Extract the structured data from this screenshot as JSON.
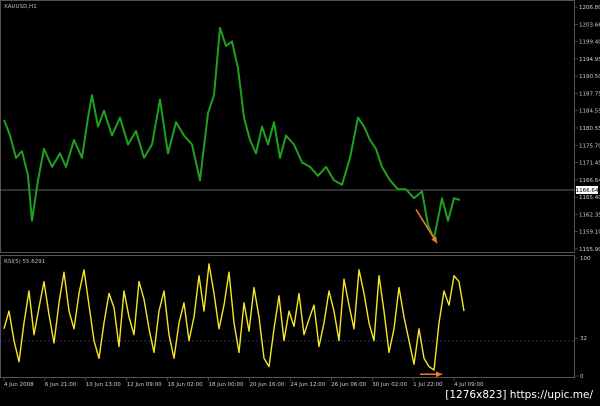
{
  "watermark": "[1276x823] https://upic.me/",
  "colors": {
    "background": "#000000",
    "price_line": "#1fa01f",
    "rsi_line": "#f5e62a",
    "arrow": "#f07a2a",
    "last_price_tag": "#ffffff"
  },
  "chart_data": [
    {
      "type": "line",
      "title": "XAUUSD,H1",
      "ylim": [
        1155.9,
        1209.0
      ],
      "y_ticks": [
        "1206.80",
        "1203.66",
        "1199.40",
        "1194.95",
        "1190.50",
        "1187.75",
        "1184.55",
        "1180.55",
        "1175.70",
        "1171.45",
        "1166.64",
        "1165.40",
        "1162.35",
        "1159.10",
        "1155.90"
      ],
      "last_price": "1166.64",
      "x": [
        0,
        6,
        12,
        18,
        24,
        28,
        34,
        40,
        48,
        56,
        62,
        70,
        78,
        84,
        88,
        94,
        100,
        108,
        116,
        124,
        132,
        140,
        148,
        156,
        164,
        172,
        180,
        188,
        196,
        204,
        210,
        216,
        222,
        228,
        234,
        240,
        246,
        252,
        258,
        264,
        270,
        276,
        282,
        290,
        298,
        306,
        314,
        322,
        330,
        338,
        346,
        354,
        360,
        366,
        372,
        378,
        386,
        394,
        402,
        410,
        418,
        424,
        430,
        434,
        438,
        444,
        450,
        456,
        460
      ],
      "series": [
        {
          "values": [
            1184.5,
            1181,
            1176,
            1177.5,
            1172,
            1162,
            1171,
            1178,
            1174,
            1177,
            1174,
            1180,
            1176,
            1185,
            1190,
            1183,
            1186.5,
            1181,
            1185,
            1179,
            1182,
            1176,
            1179,
            1189,
            1177,
            1184,
            1181,
            1179,
            1171,
            1186,
            1190,
            1205,
            1201,
            1202,
            1196,
            1185,
            1180,
            1177,
            1183,
            1179,
            1184,
            1176,
            1181,
            1179,
            1175,
            1174,
            1172,
            1174,
            1171,
            1170,
            1176,
            1185,
            1183,
            1180,
            1178,
            1174,
            1171,
            1169,
            1169,
            1167,
            1168.5,
            1161,
            1158,
            1162.5,
            1167,
            1162,
            1167,
            1166.6
          ]
        }
      ],
      "annotation": {
        "type": "arrow",
        "from": [
          412,
          1164.5
        ],
        "to": [
          433,
          1157.0
        ]
      }
    },
    {
      "type": "line",
      "title": "RSI(5) 55.6291",
      "ylim": [
        0,
        100
      ],
      "y_ticks": [
        "100",
        "32",
        "0"
      ],
      "reference_level": 32,
      "x_ticks": [
        "4 Jun 2008",
        "6 Jun 21:00",
        "10 Jun 13:00",
        "12 Jun 09:00",
        "16 Jun 02:00",
        "18 Jun 00:00",
        "20 Jun 16:00",
        "24 Jun 12:00",
        "26 Jun 06:00",
        "30 Jun 02:00",
        "1 Jul 22:00",
        "4 Jul 09:00"
      ],
      "x": [
        0,
        5,
        10,
        15,
        20,
        25,
        30,
        35,
        40,
        45,
        50,
        55,
        60,
        65,
        70,
        75,
        80,
        85,
        90,
        95,
        100,
        105,
        110,
        115,
        120,
        125,
        130,
        135,
        140,
        145,
        150,
        155,
        160,
        165,
        170,
        175,
        180,
        185,
        190,
        195,
        200,
        205,
        210,
        215,
        220,
        225,
        230,
        235,
        240,
        245,
        250,
        255,
        260,
        265,
        270,
        275,
        280,
        285,
        290,
        295,
        300,
        305,
        310,
        315,
        320,
        325,
        330,
        335,
        340,
        345,
        350,
        355,
        360,
        365,
        370,
        375,
        380,
        385,
        390,
        395,
        400,
        405,
        410,
        415,
        420,
        425,
        430,
        435,
        440,
        445,
        450,
        455,
        460
      ],
      "series": [
        {
          "values": [
            40,
            55,
            30,
            12,
            45,
            72,
            35,
            58,
            80,
            52,
            28,
            62,
            88,
            55,
            40,
            70,
            90,
            60,
            30,
            15,
            45,
            70,
            58,
            25,
            72,
            50,
            35,
            80,
            65,
            40,
            20,
            55,
            72,
            35,
            15,
            45,
            62,
            30,
            50,
            85,
            55,
            95,
            70,
            40,
            60,
            88,
            45,
            20,
            62,
            38,
            75,
            50,
            15,
            8,
            40,
            68,
            30,
            55,
            42,
            70,
            35,
            48,
            60,
            25,
            45,
            72,
            55,
            30,
            82,
            60,
            40,
            90,
            70,
            45,
            30,
            85,
            55,
            20,
            40,
            75,
            50,
            30,
            10,
            40,
            15,
            8,
            5,
            45,
            72,
            60,
            85,
            80,
            55
          ]
        }
      ],
      "annotation": {
        "type": "arrow",
        "from": [
          416,
          1.5
        ],
        "to": [
          438,
          1.5
        ]
      }
    }
  ]
}
